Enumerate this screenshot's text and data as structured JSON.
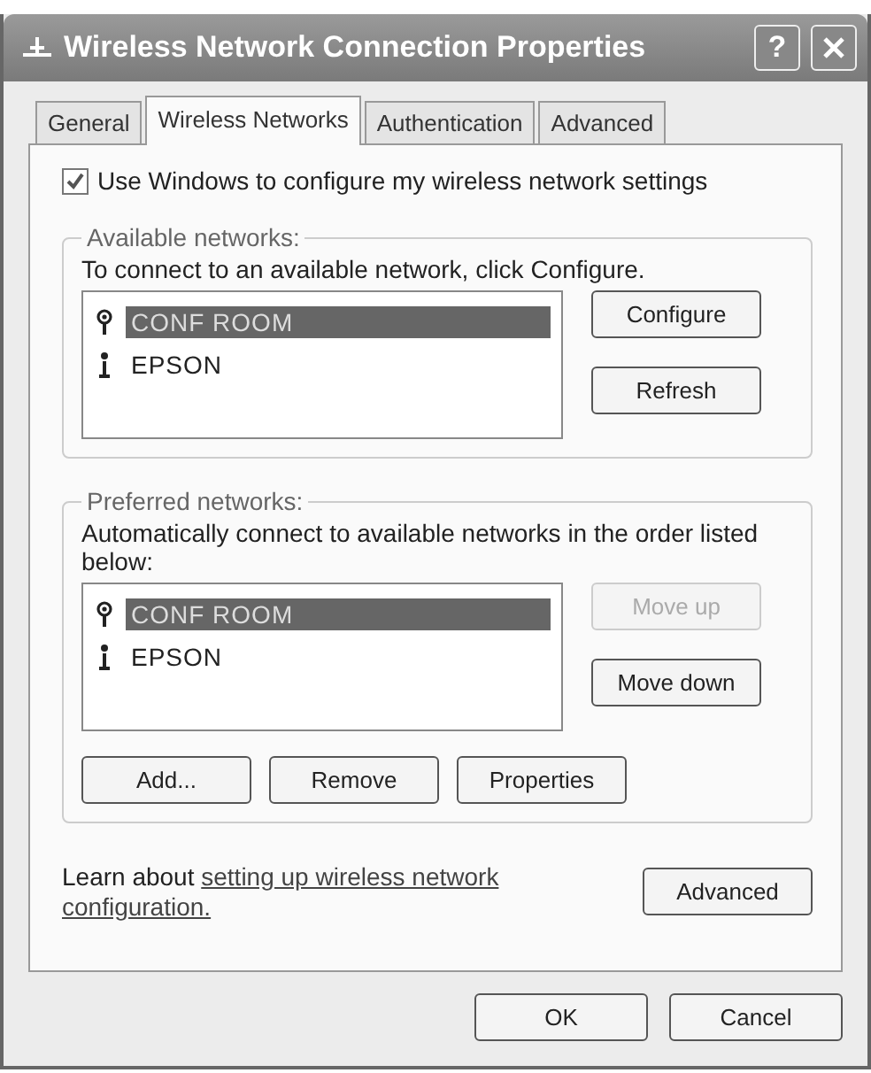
{
  "window": {
    "title": "Wireless Network Connection Properties",
    "help_label": "?"
  },
  "tabs": [
    {
      "label": "General",
      "selected": false
    },
    {
      "label": "Wireless Networks",
      "selected": true
    },
    {
      "label": "Authentication",
      "selected": false
    },
    {
      "label": "Advanced",
      "selected": false
    }
  ],
  "use_windows": {
    "label": "Use Windows to configure my wireless network settings",
    "checked": true
  },
  "available": {
    "legend": "Available networks:",
    "description": "To connect to an available network, click Configure.",
    "networks": [
      {
        "name": "CONF ROOM",
        "kind": "antenna",
        "selected": true
      },
      {
        "name": "EPSON",
        "kind": "adhoc",
        "selected": false
      }
    ],
    "buttons": [
      {
        "label": "Configure",
        "disabled": false
      },
      {
        "label": "Refresh",
        "disabled": false
      }
    ]
  },
  "preferred": {
    "legend": "Preferred networks:",
    "description": "Automatically connect to available networks in the order listed below:",
    "networks": [
      {
        "name": "CONF ROOM",
        "kind": "antenna",
        "selected": true
      },
      {
        "name": "EPSON",
        "kind": "adhoc",
        "selected": false
      }
    ],
    "buttons": [
      {
        "label": "Move up",
        "disabled": true
      },
      {
        "label": "Move down",
        "disabled": false
      }
    ],
    "actions": [
      "Add...",
      "Remove",
      "Properties"
    ]
  },
  "learn": {
    "text": "Learn about",
    "link_lines": [
      "setting up wireless network",
      "configuration."
    ]
  },
  "advanced_button": "Advanced",
  "dialog_buttons": [
    "OK",
    "Cancel"
  ]
}
